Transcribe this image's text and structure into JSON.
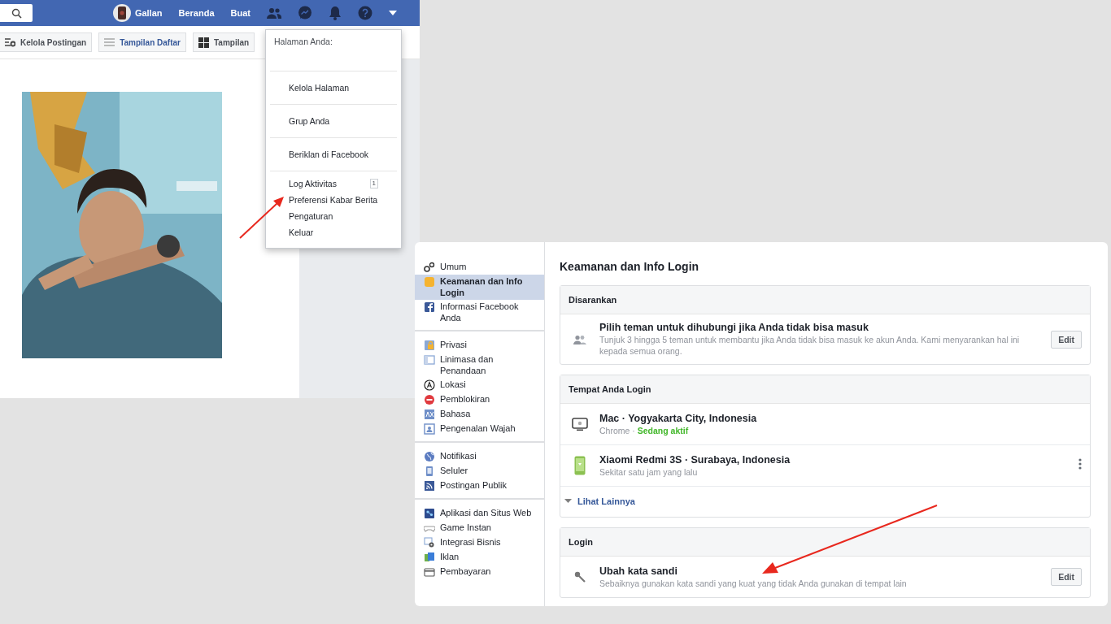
{
  "profile_screen": {
    "top_bar": {
      "nav": [
        {
          "label": "Gallan",
          "kind": "profile"
        },
        {
          "label": "Beranda",
          "kind": "link"
        },
        {
          "label": "Buat",
          "kind": "link"
        }
      ]
    },
    "toolbar": [
      {
        "label": "Kelola Postingan",
        "selected": false
      },
      {
        "label": "Tampilan Daftar",
        "selected": true
      },
      {
        "label": "Tampilan",
        "selected": false
      }
    ],
    "menu": {
      "heading": "Halaman Anda:",
      "sections": [
        [
          {
            "label": "Kelola Halaman"
          }
        ],
        [
          {
            "label": "Grup Anda"
          }
        ],
        [
          {
            "label": "Beriklan di Facebook"
          }
        ],
        [
          {
            "label": "Log Aktivitas",
            "badge": "1"
          },
          {
            "label": "Preferensi Kabar Berita"
          },
          {
            "label": "Pengaturan"
          },
          {
            "label": "Keluar"
          }
        ]
      ]
    }
  },
  "settings_screen": {
    "sidebar": {
      "groups": [
        [
          {
            "label": "Umum",
            "selected": false
          },
          {
            "label": "Keamanan dan Info Login",
            "selected": true
          },
          {
            "label": "Informasi Facebook Anda",
            "selected": false
          }
        ],
        [
          {
            "label": "Privasi",
            "selected": false
          },
          {
            "label": "Linimasa dan Penandaan",
            "selected": false
          },
          {
            "label": "Lokasi",
            "selected": false
          },
          {
            "label": "Pemblokiran",
            "selected": false
          },
          {
            "label": "Bahasa",
            "selected": false
          },
          {
            "label": "Pengenalan Wajah",
            "selected": false
          }
        ],
        [
          {
            "label": "Notifikasi",
            "selected": false
          },
          {
            "label": "Seluler",
            "selected": false
          },
          {
            "label": "Postingan Publik",
            "selected": false
          }
        ],
        [
          {
            "label": "Aplikasi dan Situs Web",
            "selected": false
          },
          {
            "label": "Game Instan",
            "selected": false
          },
          {
            "label": "Integrasi Bisnis",
            "selected": false
          },
          {
            "label": "Iklan",
            "selected": false
          },
          {
            "label": "Pembayaran",
            "selected": false
          }
        ]
      ]
    },
    "title": "Keamanan dan Info Login",
    "sections": [
      {
        "title": "Disarankan",
        "rows": [
          {
            "kind": "contacts",
            "title": "Pilih teman untuk dihubungi jika Anda tidak bisa masuk",
            "description": "Tunjuk 3 hingga 5 teman untuk membantu jika Anda tidak bisa masuk ke akun Anda. Kami menyarankan hal ini kepada semua orang.",
            "button": "Edit"
          }
        ]
      },
      {
        "title": "Tempat Anda Login",
        "rows": [
          {
            "kind": "desktop",
            "title": "Mac · Yogyakarta City, Indonesia",
            "description": "Chrome",
            "separator": "·",
            "status": "Sedang aktif"
          },
          {
            "kind": "mobile",
            "title": "Xiaomi Redmi 3S · Surabaya, Indonesia",
            "description": "Sekitar satu jam yang lalu",
            "options": true
          }
        ],
        "more": "Lihat Lainnya"
      },
      {
        "title": "Login",
        "rows": [
          {
            "kind": "password",
            "title": "Ubah kata sandi",
            "description": "Sebaiknya gunakan kata sandi yang kuat yang tidak Anda gunakan di tempat lain",
            "button": "Edit"
          }
        ]
      }
    ]
  }
}
